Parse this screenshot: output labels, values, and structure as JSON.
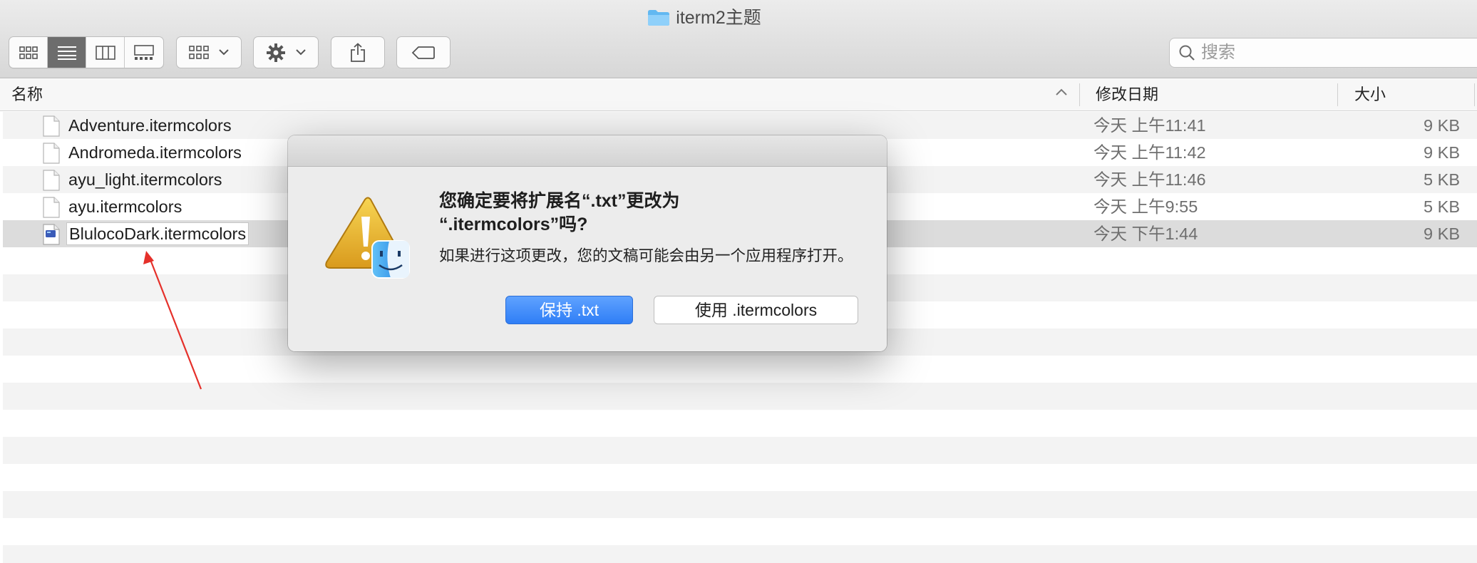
{
  "window": {
    "title": "iterm2主题"
  },
  "toolbar": {
    "view_modes": [
      "icon-view",
      "list-view",
      "column-view",
      "gallery-view"
    ],
    "active_view": "list-view"
  },
  "search": {
    "placeholder": "搜索"
  },
  "columns": {
    "name": "名称",
    "date_modified": "修改日期",
    "size": "大小"
  },
  "files": [
    {
      "name": "Adventure.itermcolors",
      "date": "今天 上午11:41",
      "size": "9 KB"
    },
    {
      "name": "Andromeda.itermcolors",
      "date": "今天 上午11:42",
      "size": "9 KB"
    },
    {
      "name": "ayu_light.itermcolors",
      "date": "今天 上午11:46",
      "size": "5 KB"
    },
    {
      "name": "ayu.itermcolors",
      "date": "今天 上午9:55",
      "size": "5 KB"
    },
    {
      "name": "BlulocoDark.itermcolors",
      "date": "今天 下午1:44",
      "size": "9 KB"
    }
  ],
  "selected_file_index": 4,
  "dialog": {
    "title_line1": "您确定要将扩展名“.txt”更改为",
    "title_line2": "“.itermcolors”吗?",
    "message": "如果进行这项更改，您的文稿可能会由另一个应用程序打开。",
    "primary_button": "保持 .txt",
    "secondary_button": "使用 .itermcolors"
  },
  "colors": {
    "accent": "#2f7ef6",
    "annotation_arrow": "#e5302a",
    "folder": "#5ab4f0"
  }
}
